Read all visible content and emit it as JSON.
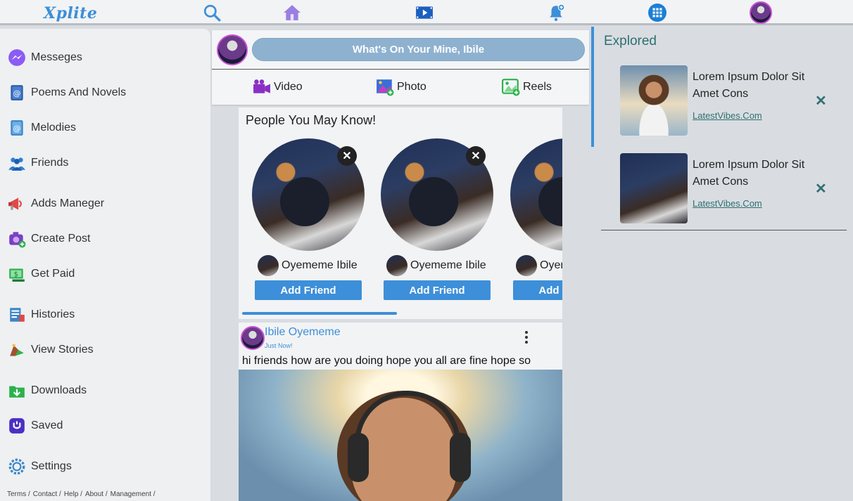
{
  "app": {
    "logo": "Xplite"
  },
  "topnav": {
    "icons": [
      "search-icon",
      "home-icon",
      "video-icon",
      "notification-bell-icon",
      "apps-grid-icon",
      "profile-avatar"
    ]
  },
  "sidebar": {
    "items": [
      {
        "label": "Messeges",
        "icon": "messenger-icon"
      },
      {
        "label": "Poems And Novels",
        "icon": "book-icon"
      },
      {
        "label": "Melodies",
        "icon": "music-book-icon"
      },
      {
        "label": "Friends",
        "icon": "friends-icon"
      },
      {
        "label": "Adds Maneger",
        "icon": "megaphone-icon"
      },
      {
        "label": "Create Post",
        "icon": "camera-add-icon"
      },
      {
        "label": "Get Paid",
        "icon": "money-icon"
      },
      {
        "label": "Histories",
        "icon": "history-icon"
      },
      {
        "label": "View Stories",
        "icon": "stories-icon"
      },
      {
        "label": "Downloads",
        "icon": "download-folder-icon"
      },
      {
        "label": "Saved",
        "icon": "saved-icon"
      },
      {
        "label": "Settings",
        "icon": "gear-icon"
      }
    ],
    "footer_links": [
      "Terms /",
      "Contact /",
      "Help /",
      "About /",
      "Management /"
    ]
  },
  "composer": {
    "prompt": "What's On Your Mine, Ibile",
    "actions": [
      {
        "label": "Video",
        "icon": "video-camera-icon"
      },
      {
        "label": "Photo",
        "icon": "photo-add-icon"
      },
      {
        "label": "Reels",
        "icon": "reels-icon"
      }
    ]
  },
  "people_you_may_know": {
    "title": "People You May Know!",
    "cards": [
      {
        "name": "Oyememe Ibile",
        "button": "Add Friend",
        "close": "✕"
      },
      {
        "name": "Oyememe Ibile",
        "button": "Add Friend",
        "close": "✕"
      },
      {
        "name": "Oyememe Ibile",
        "button": "Add Friend",
        "close": "✕"
      }
    ]
  },
  "post": {
    "author": "Ibile Oyememe",
    "time": "Just Now!",
    "text": "hi friends how are you doing hope you all are fine hope so"
  },
  "explored": {
    "title": "Explored",
    "items": [
      {
        "title": "Lorem Ipsum Dolor Sit Amet Cons",
        "link": "LatestVibes.Com",
        "close": "✕"
      },
      {
        "title": "Lorem Ipsum Dolor Sit Amet Cons",
        "link": "LatestVibes.Com",
        "close": "✕"
      }
    ]
  },
  "colors": {
    "accent": "#3d8fd9",
    "teal": "#2f6f72",
    "prompt_bg": "#8eb1d0"
  }
}
